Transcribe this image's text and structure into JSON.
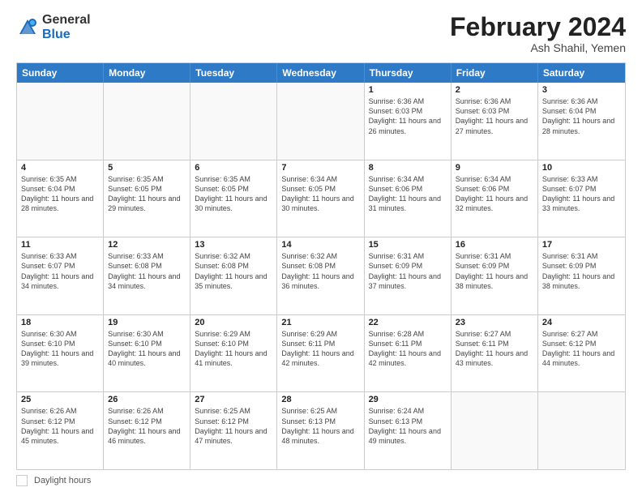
{
  "header": {
    "logo_general": "General",
    "logo_blue": "Blue",
    "month_year": "February 2024",
    "location": "Ash Shahil, Yemen"
  },
  "days_of_week": [
    "Sunday",
    "Monday",
    "Tuesday",
    "Wednesday",
    "Thursday",
    "Friday",
    "Saturday"
  ],
  "weeks": [
    [
      {
        "day": "",
        "sunrise": "",
        "sunset": "",
        "daylight": "",
        "empty": true
      },
      {
        "day": "",
        "sunrise": "",
        "sunset": "",
        "daylight": "",
        "empty": true
      },
      {
        "day": "",
        "sunrise": "",
        "sunset": "",
        "daylight": "",
        "empty": true
      },
      {
        "day": "",
        "sunrise": "",
        "sunset": "",
        "daylight": "",
        "empty": true
      },
      {
        "day": "1",
        "sunrise": "Sunrise: 6:36 AM",
        "sunset": "Sunset: 6:03 PM",
        "daylight": "Daylight: 11 hours and 26 minutes.",
        "empty": false
      },
      {
        "day": "2",
        "sunrise": "Sunrise: 6:36 AM",
        "sunset": "Sunset: 6:03 PM",
        "daylight": "Daylight: 11 hours and 27 minutes.",
        "empty": false
      },
      {
        "day": "3",
        "sunrise": "Sunrise: 6:36 AM",
        "sunset": "Sunset: 6:04 PM",
        "daylight": "Daylight: 11 hours and 28 minutes.",
        "empty": false
      }
    ],
    [
      {
        "day": "4",
        "sunrise": "Sunrise: 6:35 AM",
        "sunset": "Sunset: 6:04 PM",
        "daylight": "Daylight: 11 hours and 28 minutes.",
        "empty": false
      },
      {
        "day": "5",
        "sunrise": "Sunrise: 6:35 AM",
        "sunset": "Sunset: 6:05 PM",
        "daylight": "Daylight: 11 hours and 29 minutes.",
        "empty": false
      },
      {
        "day": "6",
        "sunrise": "Sunrise: 6:35 AM",
        "sunset": "Sunset: 6:05 PM",
        "daylight": "Daylight: 11 hours and 30 minutes.",
        "empty": false
      },
      {
        "day": "7",
        "sunrise": "Sunrise: 6:34 AM",
        "sunset": "Sunset: 6:05 PM",
        "daylight": "Daylight: 11 hours and 30 minutes.",
        "empty": false
      },
      {
        "day": "8",
        "sunrise": "Sunrise: 6:34 AM",
        "sunset": "Sunset: 6:06 PM",
        "daylight": "Daylight: 11 hours and 31 minutes.",
        "empty": false
      },
      {
        "day": "9",
        "sunrise": "Sunrise: 6:34 AM",
        "sunset": "Sunset: 6:06 PM",
        "daylight": "Daylight: 11 hours and 32 minutes.",
        "empty": false
      },
      {
        "day": "10",
        "sunrise": "Sunrise: 6:33 AM",
        "sunset": "Sunset: 6:07 PM",
        "daylight": "Daylight: 11 hours and 33 minutes.",
        "empty": false
      }
    ],
    [
      {
        "day": "11",
        "sunrise": "Sunrise: 6:33 AM",
        "sunset": "Sunset: 6:07 PM",
        "daylight": "Daylight: 11 hours and 34 minutes.",
        "empty": false
      },
      {
        "day": "12",
        "sunrise": "Sunrise: 6:33 AM",
        "sunset": "Sunset: 6:08 PM",
        "daylight": "Daylight: 11 hours and 34 minutes.",
        "empty": false
      },
      {
        "day": "13",
        "sunrise": "Sunrise: 6:32 AM",
        "sunset": "Sunset: 6:08 PM",
        "daylight": "Daylight: 11 hours and 35 minutes.",
        "empty": false
      },
      {
        "day": "14",
        "sunrise": "Sunrise: 6:32 AM",
        "sunset": "Sunset: 6:08 PM",
        "daylight": "Daylight: 11 hours and 36 minutes.",
        "empty": false
      },
      {
        "day": "15",
        "sunrise": "Sunrise: 6:31 AM",
        "sunset": "Sunset: 6:09 PM",
        "daylight": "Daylight: 11 hours and 37 minutes.",
        "empty": false
      },
      {
        "day": "16",
        "sunrise": "Sunrise: 6:31 AM",
        "sunset": "Sunset: 6:09 PM",
        "daylight": "Daylight: 11 hours and 38 minutes.",
        "empty": false
      },
      {
        "day": "17",
        "sunrise": "Sunrise: 6:31 AM",
        "sunset": "Sunset: 6:09 PM",
        "daylight": "Daylight: 11 hours and 38 minutes.",
        "empty": false
      }
    ],
    [
      {
        "day": "18",
        "sunrise": "Sunrise: 6:30 AM",
        "sunset": "Sunset: 6:10 PM",
        "daylight": "Daylight: 11 hours and 39 minutes.",
        "empty": false
      },
      {
        "day": "19",
        "sunrise": "Sunrise: 6:30 AM",
        "sunset": "Sunset: 6:10 PM",
        "daylight": "Daylight: 11 hours and 40 minutes.",
        "empty": false
      },
      {
        "day": "20",
        "sunrise": "Sunrise: 6:29 AM",
        "sunset": "Sunset: 6:10 PM",
        "daylight": "Daylight: 11 hours and 41 minutes.",
        "empty": false
      },
      {
        "day": "21",
        "sunrise": "Sunrise: 6:29 AM",
        "sunset": "Sunset: 6:11 PM",
        "daylight": "Daylight: 11 hours and 42 minutes.",
        "empty": false
      },
      {
        "day": "22",
        "sunrise": "Sunrise: 6:28 AM",
        "sunset": "Sunset: 6:11 PM",
        "daylight": "Daylight: 11 hours and 42 minutes.",
        "empty": false
      },
      {
        "day": "23",
        "sunrise": "Sunrise: 6:27 AM",
        "sunset": "Sunset: 6:11 PM",
        "daylight": "Daylight: 11 hours and 43 minutes.",
        "empty": false
      },
      {
        "day": "24",
        "sunrise": "Sunrise: 6:27 AM",
        "sunset": "Sunset: 6:12 PM",
        "daylight": "Daylight: 11 hours and 44 minutes.",
        "empty": false
      }
    ],
    [
      {
        "day": "25",
        "sunrise": "Sunrise: 6:26 AM",
        "sunset": "Sunset: 6:12 PM",
        "daylight": "Daylight: 11 hours and 45 minutes.",
        "empty": false
      },
      {
        "day": "26",
        "sunrise": "Sunrise: 6:26 AM",
        "sunset": "Sunset: 6:12 PM",
        "daylight": "Daylight: 11 hours and 46 minutes.",
        "empty": false
      },
      {
        "day": "27",
        "sunrise": "Sunrise: 6:25 AM",
        "sunset": "Sunset: 6:12 PM",
        "daylight": "Daylight: 11 hours and 47 minutes.",
        "empty": false
      },
      {
        "day": "28",
        "sunrise": "Sunrise: 6:25 AM",
        "sunset": "Sunset: 6:13 PM",
        "daylight": "Daylight: 11 hours and 48 minutes.",
        "empty": false
      },
      {
        "day": "29",
        "sunrise": "Sunrise: 6:24 AM",
        "sunset": "Sunset: 6:13 PM",
        "daylight": "Daylight: 11 hours and 49 minutes.",
        "empty": false
      },
      {
        "day": "",
        "sunrise": "",
        "sunset": "",
        "daylight": "",
        "empty": true
      },
      {
        "day": "",
        "sunrise": "",
        "sunset": "",
        "daylight": "",
        "empty": true
      }
    ]
  ],
  "footer": {
    "daylight_hours_label": "Daylight hours"
  }
}
